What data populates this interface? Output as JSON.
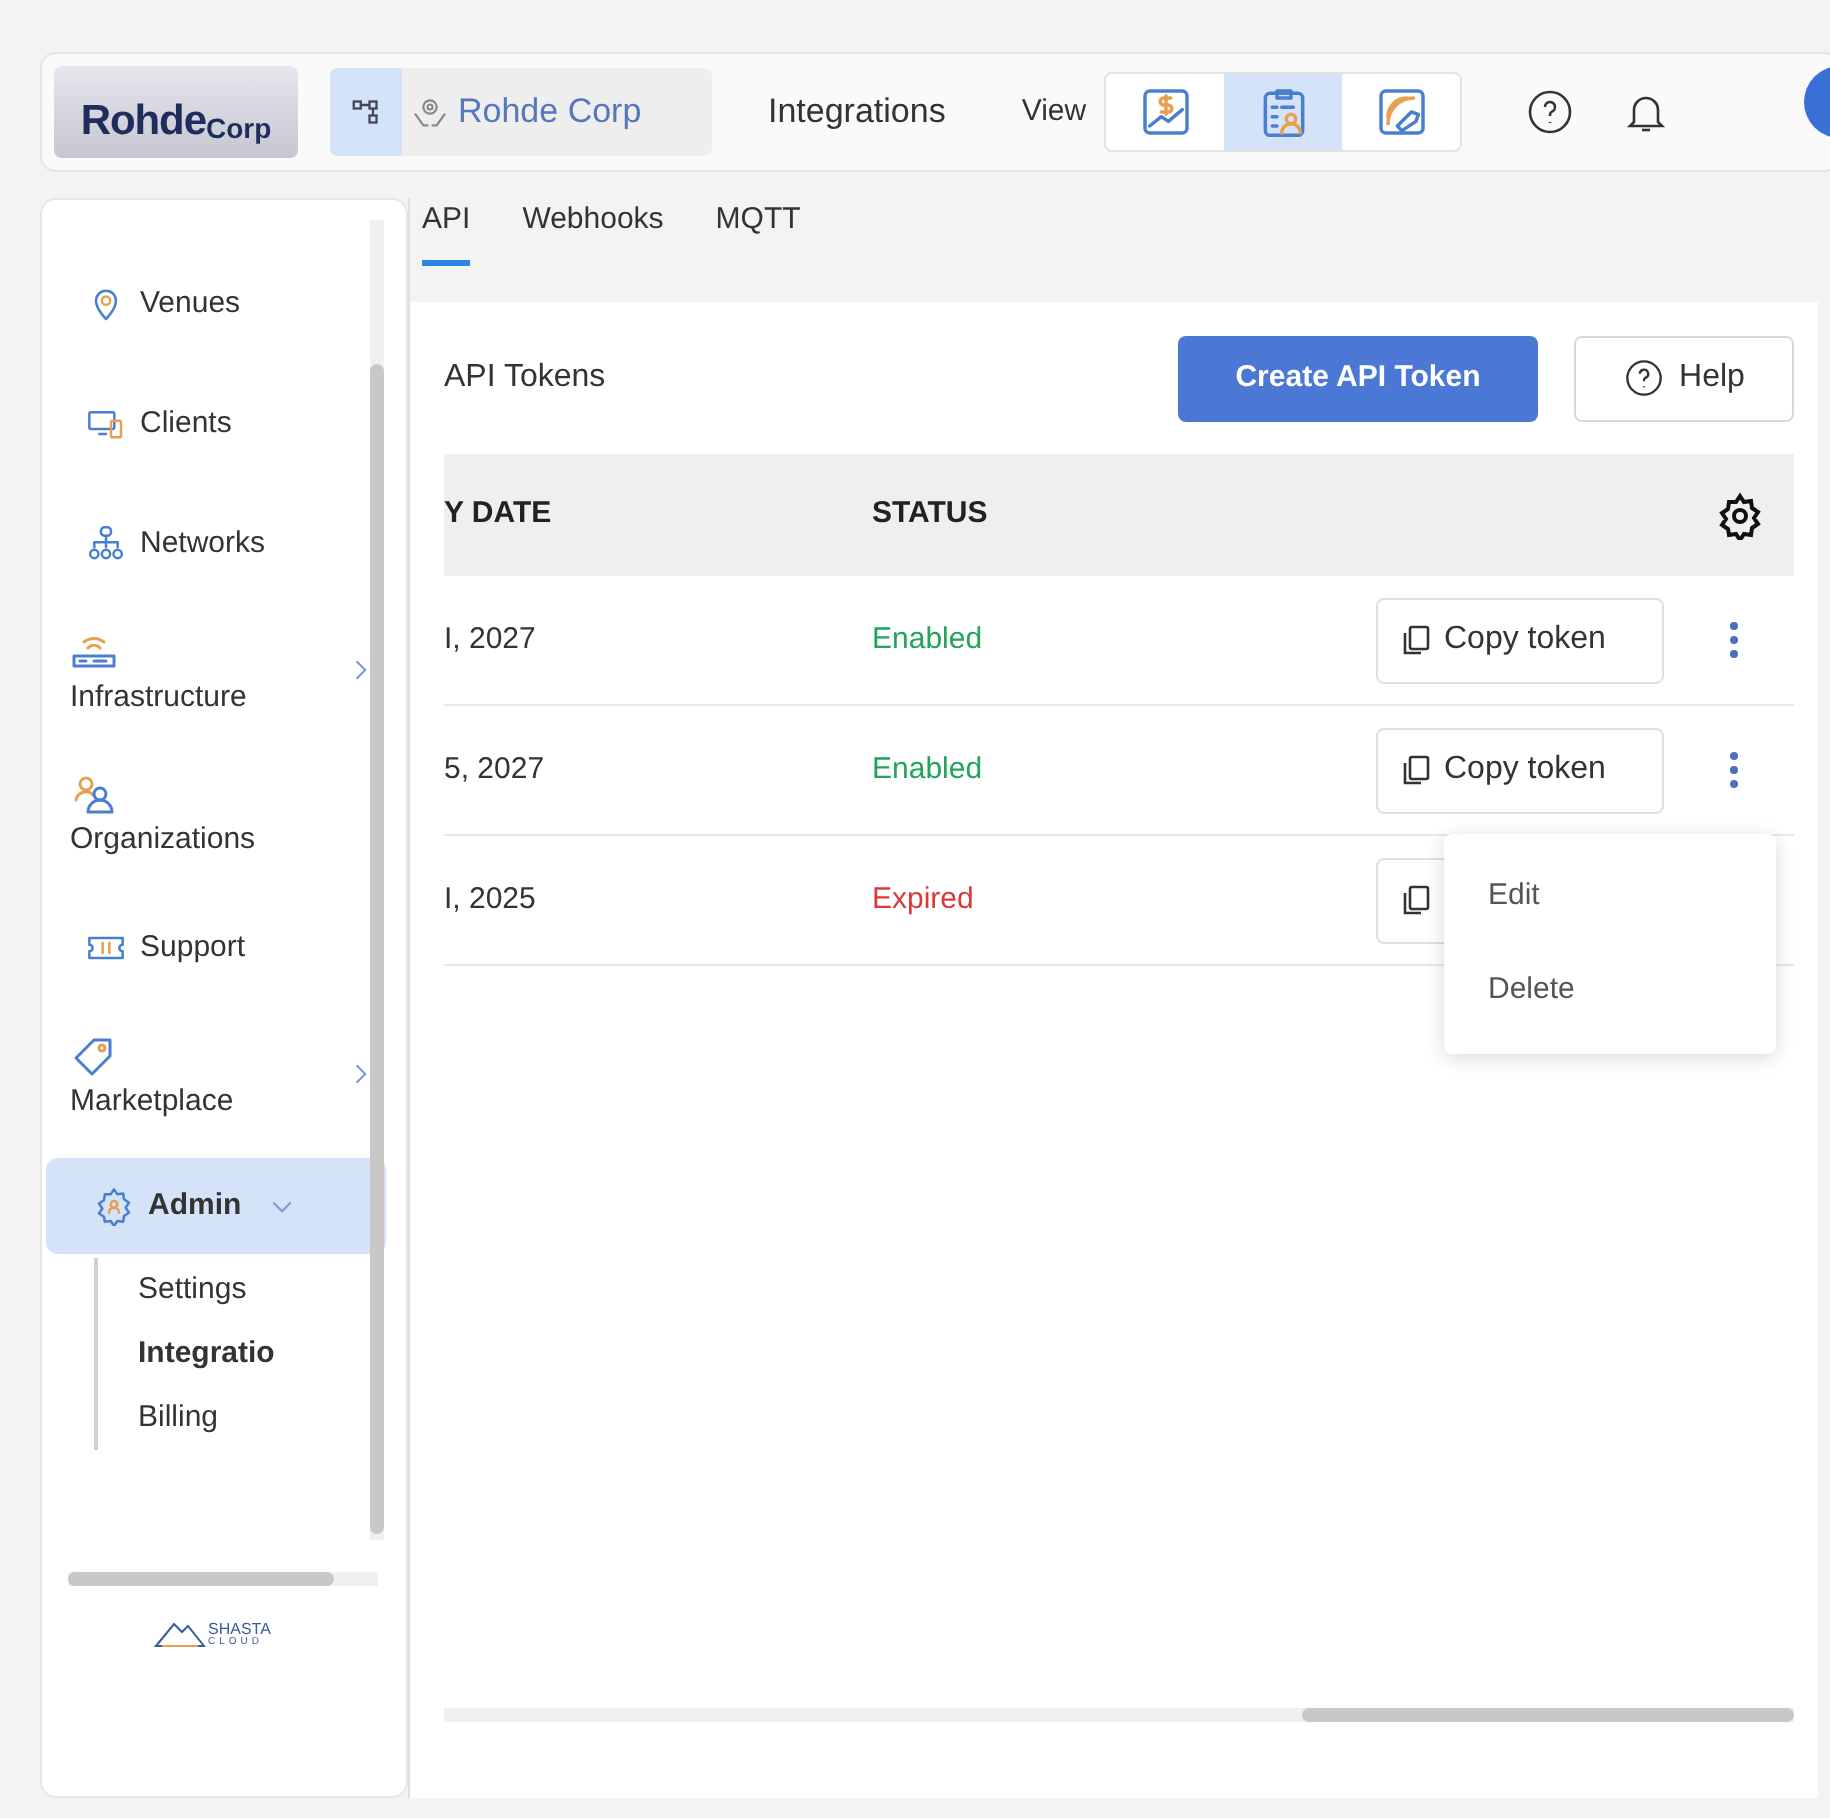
{
  "header": {
    "logo": {
      "main": "Rohde",
      "suffix": "Corp"
    },
    "org_name": "Rohde Corp",
    "page_title": "Integrations",
    "view_label": "View",
    "view_options": [
      {
        "kind": "finance",
        "selected": false
      },
      {
        "kind": "report",
        "selected": true
      },
      {
        "kind": "tools",
        "selected": false
      }
    ]
  },
  "sidebar": {
    "items": [
      {
        "kind": "inline",
        "label": "Venues"
      },
      {
        "kind": "inline",
        "label": "Clients"
      },
      {
        "kind": "inline",
        "label": "Networks"
      },
      {
        "kind": "stacked",
        "label": "Infrastructure",
        "expanded": false
      },
      {
        "kind": "stacked",
        "label": "Organizations"
      },
      {
        "kind": "inline",
        "label": "Support"
      },
      {
        "kind": "stacked",
        "label": "Marketplace",
        "expanded": false
      },
      {
        "kind": "inline",
        "label": "Admin",
        "expanded": true,
        "children": [
          {
            "label": "Settings",
            "selected": false
          },
          {
            "label": "Integratio",
            "selected": true
          },
          {
            "label": "Billing",
            "selected": false
          }
        ]
      }
    ],
    "footer_logo": {
      "main": "SHASTA",
      "sub": "CLOUD"
    }
  },
  "tabs": [
    {
      "label": "API",
      "selected": true
    },
    {
      "label": "Webhooks",
      "selected": false
    },
    {
      "label": "MQTT",
      "selected": false
    }
  ],
  "card": {
    "title": "API Tokens",
    "create_button": "Create API Token",
    "help_button": "Help",
    "table": {
      "columns": [
        "Y DATE",
        "STATUS"
      ],
      "rows": [
        {
          "date": "I, 2027",
          "status": "Enabled",
          "color": "#22a55a",
          "copy_label": "Copy token"
        },
        {
          "date": "5, 2027",
          "status": "Enabled",
          "color": "#22a55a",
          "copy_label": "Copy token"
        },
        {
          "date": "I, 2025",
          "status": "Expired",
          "color": "#dc3a3a"
        }
      ]
    },
    "menu": {
      "open": true,
      "items": [
        "Edit",
        "Delete"
      ]
    }
  }
}
